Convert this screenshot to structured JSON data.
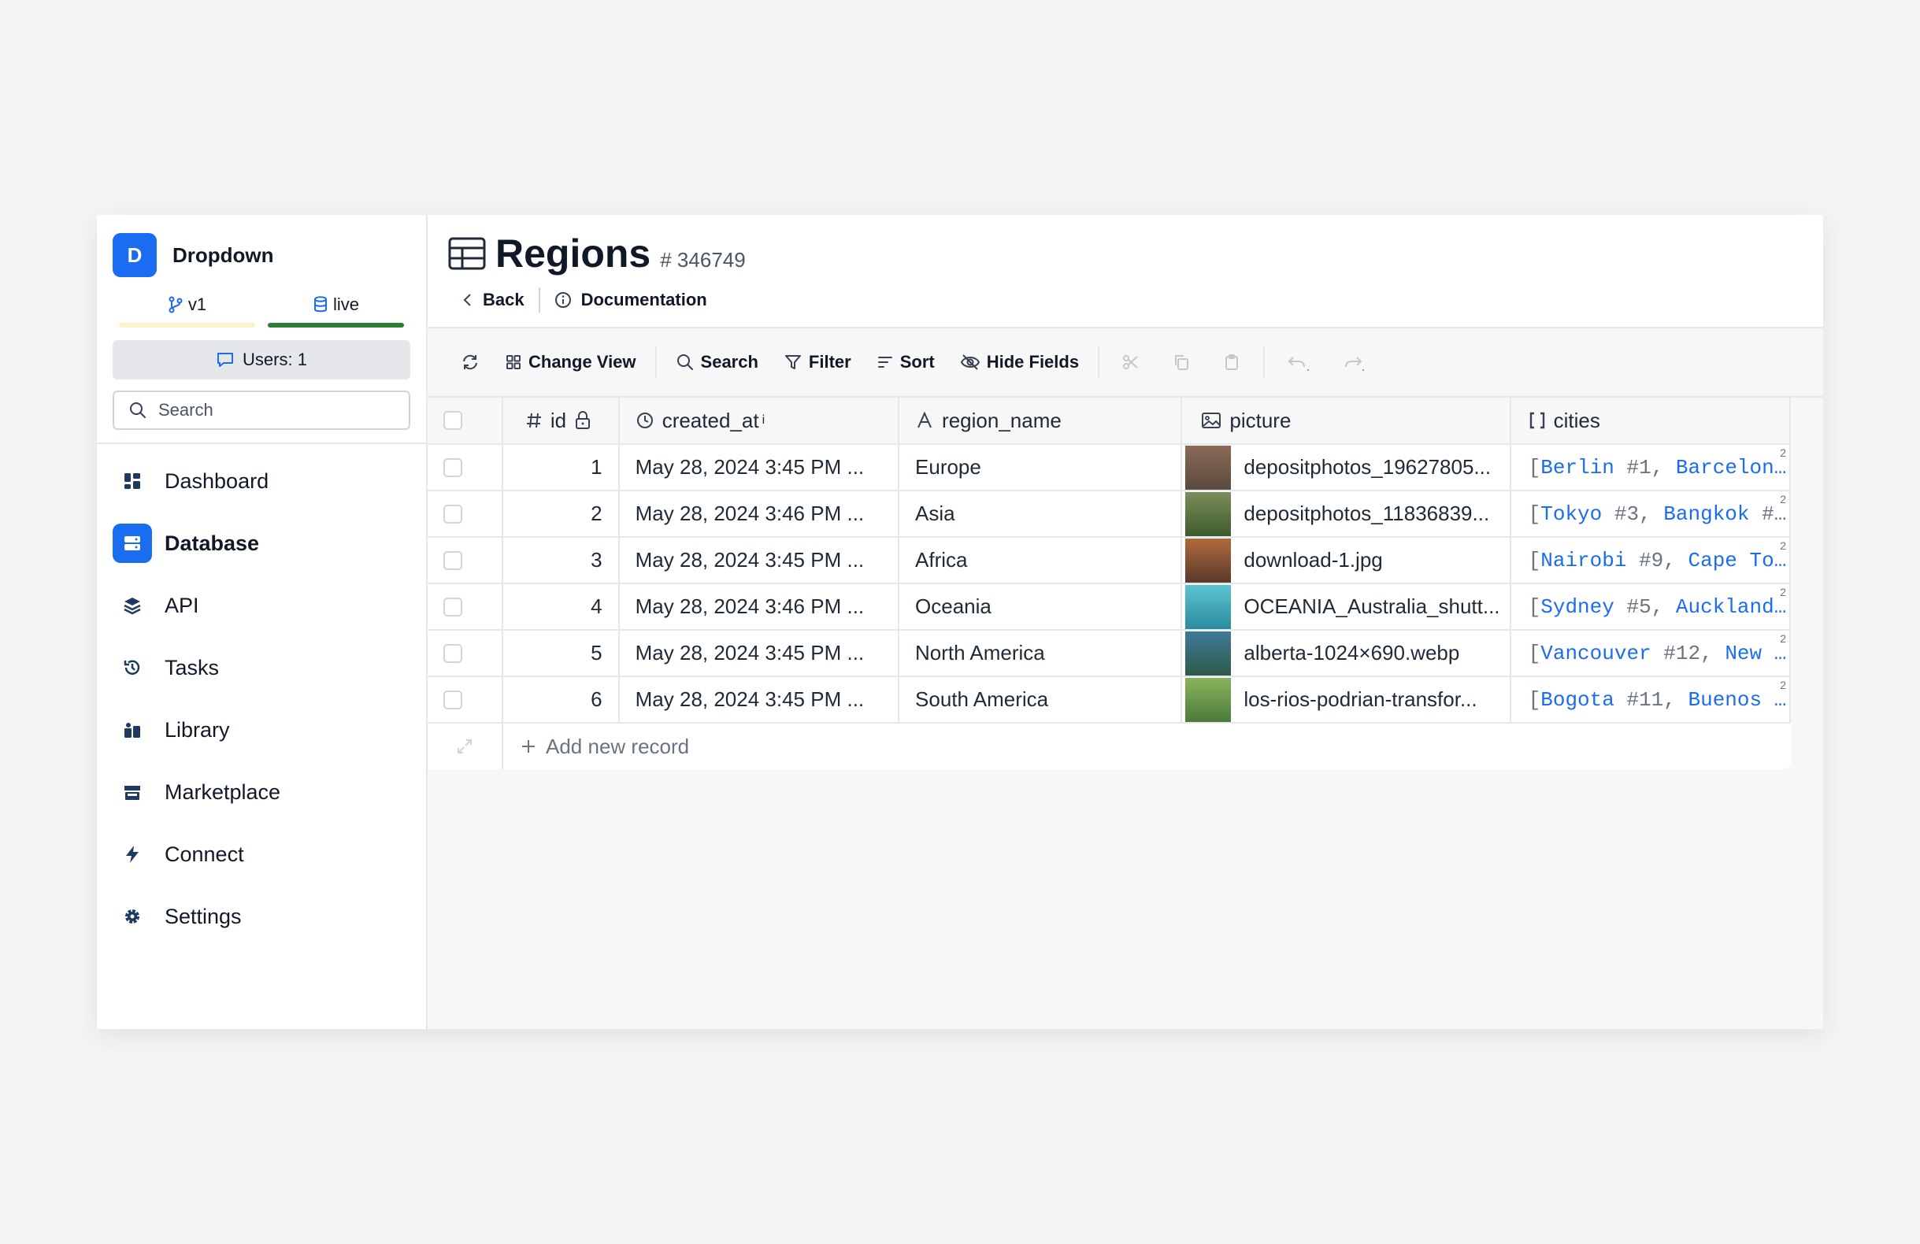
{
  "workspace": {
    "initial": "D",
    "name": "Dropdown"
  },
  "branches": [
    {
      "label": "v1",
      "bar_color": "#fdf3c8"
    },
    {
      "label": "live",
      "bar_color": "#2e7d32"
    }
  ],
  "users_label": "Users: 1",
  "sidebar_search": {
    "placeholder": "Search"
  },
  "nav": [
    {
      "label": "Dashboard",
      "icon": "dashboard-icon"
    },
    {
      "label": "Database",
      "icon": "database-icon",
      "active": true
    },
    {
      "label": "API",
      "icon": "api-layers-icon"
    },
    {
      "label": "Tasks",
      "icon": "tasks-history-icon"
    },
    {
      "label": "Library",
      "icon": "library-icon"
    },
    {
      "label": "Marketplace",
      "icon": "marketplace-icon"
    },
    {
      "label": "Connect",
      "icon": "connect-bolt-icon"
    },
    {
      "label": "Settings",
      "icon": "gear-icon"
    }
  ],
  "table": {
    "title": "Regions",
    "id_label": "# 346749"
  },
  "subnav": {
    "back": "Back",
    "docs": "Documentation"
  },
  "toolbar": {
    "change_view": "Change View",
    "search": "Search",
    "filter": "Filter",
    "sort": "Sort",
    "hide_fields": "Hide Fields"
  },
  "columns": {
    "id": "id",
    "created_at": "created_at",
    "created_at_sup": "i",
    "region_name": "region_name",
    "picture": "picture",
    "cities": "cities"
  },
  "rows": [
    {
      "id": "1",
      "created_at": "May 28, 2024 3:45 PM ...",
      "region": "Europe",
      "picture": "depositphotos_19627805...",
      "thumb_colors": [
        "#8a6a55",
        "#5b4a3e"
      ],
      "city1": "Berlin",
      "ref1": "#1",
      "city2": "Barcelon…",
      "ref2": "",
      "count": "2"
    },
    {
      "id": "2",
      "created_at": "May 28, 2024 3:46 PM ...",
      "region": "Asia",
      "picture": "depositphotos_11836839...",
      "thumb_colors": [
        "#7a8e5a",
        "#3e5a2e"
      ],
      "city1": "Tokyo",
      "ref1": "#3",
      "city2": "Bangkok",
      "ref2": "#…",
      "count": "2"
    },
    {
      "id": "3",
      "created_at": "May 28, 2024 3:45 PM ...",
      "region": "Africa",
      "picture": "download-1.jpg",
      "thumb_colors": [
        "#b06a3e",
        "#5a3a2a"
      ],
      "city1": "Nairobi",
      "ref1": "#9",
      "city2": "Cape To…",
      "ref2": "",
      "count": "2"
    },
    {
      "id": "4",
      "created_at": "May 28, 2024 3:46 PM ...",
      "region": "Oceania",
      "picture": "OCEANIA_Australia_shutt...",
      "thumb_colors": [
        "#5ec4d0",
        "#2a8a9e"
      ],
      "city1": "Sydney",
      "ref1": "#5",
      "city2": "Auckland…",
      "ref2": "",
      "count": "2"
    },
    {
      "id": "5",
      "created_at": "May 28, 2024 3:45 PM ...",
      "region": "North America",
      "picture": "alberta-1024×690.webp",
      "thumb_colors": [
        "#3e7a9a",
        "#2e5a4a"
      ],
      "city1": "Vancouver",
      "ref1": "#12",
      "city2": "New …",
      "ref2": "",
      "count": "2"
    },
    {
      "id": "6",
      "created_at": "May 28, 2024 3:45 PM ...",
      "region": "South America",
      "picture": "los-rios-podrian-transfor...",
      "thumb_colors": [
        "#8ab45a",
        "#4a7a3a"
      ],
      "city1": "Bogota",
      "ref1": "#11",
      "city2": "Buenos …",
      "ref2": "",
      "count": "2"
    }
  ],
  "add_record": "Add new record",
  "colors": {
    "accent": "#1a6cf0",
    "link": "#1a6cf0"
  }
}
